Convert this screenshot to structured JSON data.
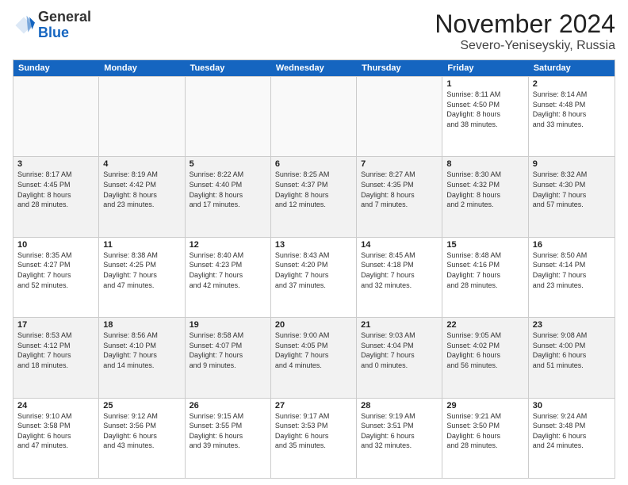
{
  "header": {
    "logo_line1": "General",
    "logo_line2": "Blue",
    "month": "November 2024",
    "location": "Severo-Yeniseyskiy, Russia"
  },
  "weekdays": [
    "Sunday",
    "Monday",
    "Tuesday",
    "Wednesday",
    "Thursday",
    "Friday",
    "Saturday"
  ],
  "rows": [
    [
      {
        "day": "",
        "info": "",
        "empty": true
      },
      {
        "day": "",
        "info": "",
        "empty": true
      },
      {
        "day": "",
        "info": "",
        "empty": true
      },
      {
        "day": "",
        "info": "",
        "empty": true
      },
      {
        "day": "",
        "info": "",
        "empty": true
      },
      {
        "day": "1",
        "info": "Sunrise: 8:11 AM\nSunset: 4:50 PM\nDaylight: 8 hours\nand 38 minutes.",
        "empty": false
      },
      {
        "day": "2",
        "info": "Sunrise: 8:14 AM\nSunset: 4:48 PM\nDaylight: 8 hours\nand 33 minutes.",
        "empty": false
      }
    ],
    [
      {
        "day": "3",
        "info": "Sunrise: 8:17 AM\nSunset: 4:45 PM\nDaylight: 8 hours\nand 28 minutes.",
        "empty": false
      },
      {
        "day": "4",
        "info": "Sunrise: 8:19 AM\nSunset: 4:42 PM\nDaylight: 8 hours\nand 23 minutes.",
        "empty": false
      },
      {
        "day": "5",
        "info": "Sunrise: 8:22 AM\nSunset: 4:40 PM\nDaylight: 8 hours\nand 17 minutes.",
        "empty": false
      },
      {
        "day": "6",
        "info": "Sunrise: 8:25 AM\nSunset: 4:37 PM\nDaylight: 8 hours\nand 12 minutes.",
        "empty": false
      },
      {
        "day": "7",
        "info": "Sunrise: 8:27 AM\nSunset: 4:35 PM\nDaylight: 8 hours\nand 7 minutes.",
        "empty": false
      },
      {
        "day": "8",
        "info": "Sunrise: 8:30 AM\nSunset: 4:32 PM\nDaylight: 8 hours\nand 2 minutes.",
        "empty": false
      },
      {
        "day": "9",
        "info": "Sunrise: 8:32 AM\nSunset: 4:30 PM\nDaylight: 7 hours\nand 57 minutes.",
        "empty": false
      }
    ],
    [
      {
        "day": "10",
        "info": "Sunrise: 8:35 AM\nSunset: 4:27 PM\nDaylight: 7 hours\nand 52 minutes.",
        "empty": false
      },
      {
        "day": "11",
        "info": "Sunrise: 8:38 AM\nSunset: 4:25 PM\nDaylight: 7 hours\nand 47 minutes.",
        "empty": false
      },
      {
        "day": "12",
        "info": "Sunrise: 8:40 AM\nSunset: 4:23 PM\nDaylight: 7 hours\nand 42 minutes.",
        "empty": false
      },
      {
        "day": "13",
        "info": "Sunrise: 8:43 AM\nSunset: 4:20 PM\nDaylight: 7 hours\nand 37 minutes.",
        "empty": false
      },
      {
        "day": "14",
        "info": "Sunrise: 8:45 AM\nSunset: 4:18 PM\nDaylight: 7 hours\nand 32 minutes.",
        "empty": false
      },
      {
        "day": "15",
        "info": "Sunrise: 8:48 AM\nSunset: 4:16 PM\nDaylight: 7 hours\nand 28 minutes.",
        "empty": false
      },
      {
        "day": "16",
        "info": "Sunrise: 8:50 AM\nSunset: 4:14 PM\nDaylight: 7 hours\nand 23 minutes.",
        "empty": false
      }
    ],
    [
      {
        "day": "17",
        "info": "Sunrise: 8:53 AM\nSunset: 4:12 PM\nDaylight: 7 hours\nand 18 minutes.",
        "empty": false
      },
      {
        "day": "18",
        "info": "Sunrise: 8:56 AM\nSunset: 4:10 PM\nDaylight: 7 hours\nand 14 minutes.",
        "empty": false
      },
      {
        "day": "19",
        "info": "Sunrise: 8:58 AM\nSunset: 4:07 PM\nDaylight: 7 hours\nand 9 minutes.",
        "empty": false
      },
      {
        "day": "20",
        "info": "Sunrise: 9:00 AM\nSunset: 4:05 PM\nDaylight: 7 hours\nand 4 minutes.",
        "empty": false
      },
      {
        "day": "21",
        "info": "Sunrise: 9:03 AM\nSunset: 4:04 PM\nDaylight: 7 hours\nand 0 minutes.",
        "empty": false
      },
      {
        "day": "22",
        "info": "Sunrise: 9:05 AM\nSunset: 4:02 PM\nDaylight: 6 hours\nand 56 minutes.",
        "empty": false
      },
      {
        "day": "23",
        "info": "Sunrise: 9:08 AM\nSunset: 4:00 PM\nDaylight: 6 hours\nand 51 minutes.",
        "empty": false
      }
    ],
    [
      {
        "day": "24",
        "info": "Sunrise: 9:10 AM\nSunset: 3:58 PM\nDaylight: 6 hours\nand 47 minutes.",
        "empty": false
      },
      {
        "day": "25",
        "info": "Sunrise: 9:12 AM\nSunset: 3:56 PM\nDaylight: 6 hours\nand 43 minutes.",
        "empty": false
      },
      {
        "day": "26",
        "info": "Sunrise: 9:15 AM\nSunset: 3:55 PM\nDaylight: 6 hours\nand 39 minutes.",
        "empty": false
      },
      {
        "day": "27",
        "info": "Sunrise: 9:17 AM\nSunset: 3:53 PM\nDaylight: 6 hours\nand 35 minutes.",
        "empty": false
      },
      {
        "day": "28",
        "info": "Sunrise: 9:19 AM\nSunset: 3:51 PM\nDaylight: 6 hours\nand 32 minutes.",
        "empty": false
      },
      {
        "day": "29",
        "info": "Sunrise: 9:21 AM\nSunset: 3:50 PM\nDaylight: 6 hours\nand 28 minutes.",
        "empty": false
      },
      {
        "day": "30",
        "info": "Sunrise: 9:24 AM\nSunset: 3:48 PM\nDaylight: 6 hours\nand 24 minutes.",
        "empty": false
      }
    ]
  ]
}
